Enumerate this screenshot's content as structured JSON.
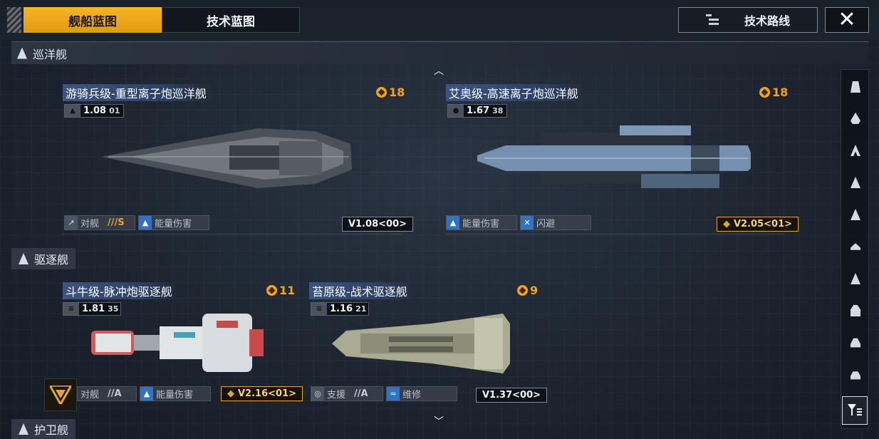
{
  "tabs": [
    {
      "label": "舰船蓝图",
      "active": true
    },
    {
      "label": "技术蓝图",
      "active": false
    }
  ],
  "tech_route_label": "技术路线",
  "close_icon": "close-icon",
  "sections": {
    "cruiser": "巡洋舰",
    "destroyer": "驱逐舰",
    "frigate": "护卫舰"
  },
  "cards": [
    {
      "name": "游骑兵级-重型离子炮巡洋舰",
      "cost": "18",
      "stat": "1.08",
      "stat_sub": "01",
      "tags": [
        {
          "label": "对舰",
          "grade": "///S",
          "icon": "anti-ship-icon"
        },
        {
          "label": "能量伤害",
          "icon": "energy-damage-icon"
        }
      ],
      "version": "V1.08<00>",
      "version_highlight": false,
      "hull_color": "#5d646c"
    },
    {
      "name": "艾奥级-高速离子炮巡洋舰",
      "cost": "18",
      "stat": "1.67",
      "stat_sub": "38",
      "tags": [
        {
          "label": "能量伤害",
          "icon": "energy-damage-icon"
        },
        {
          "label": "闪避",
          "icon": "evade-icon"
        }
      ],
      "version": "V2.05<01>",
      "version_highlight": true,
      "hull_color": "#6f8aa8"
    },
    {
      "name": "斗牛级-脉冲炮驱逐舰",
      "cost": "11",
      "stat": "1.81",
      "stat_sub": "35",
      "tags": [
        {
          "label": "对舰",
          "grade": "//A",
          "icon": "anti-ship-icon"
        },
        {
          "label": "能量伤害",
          "icon": "energy-damage-icon"
        }
      ],
      "version": "V2.16<01>",
      "version_highlight": true,
      "hull_color": "#d8dde2"
    },
    {
      "name": "苔原级-战术驱逐舰",
      "cost": "9",
      "stat": "1.16",
      "stat_sub": "21",
      "tags": [
        {
          "label": "支援",
          "grade": "//A",
          "icon": "support-icon"
        },
        {
          "label": "维修",
          "icon": "repair-icon"
        }
      ],
      "version": "V1.37<00>",
      "version_highlight": false,
      "hull_color": "#b3b59a"
    }
  ],
  "rail_items": [
    "category-1-icon",
    "category-2-icon",
    "category-3-icon",
    "category-4-icon",
    "category-5-icon",
    "category-6-icon",
    "category-7-icon",
    "category-8-icon",
    "category-9-icon",
    "category-10-icon",
    "filter-icon"
  ],
  "colors": {
    "accent": "#f2a51b",
    "title_bar": "#3c5482",
    "highlight_blue": "#2f74c4"
  }
}
